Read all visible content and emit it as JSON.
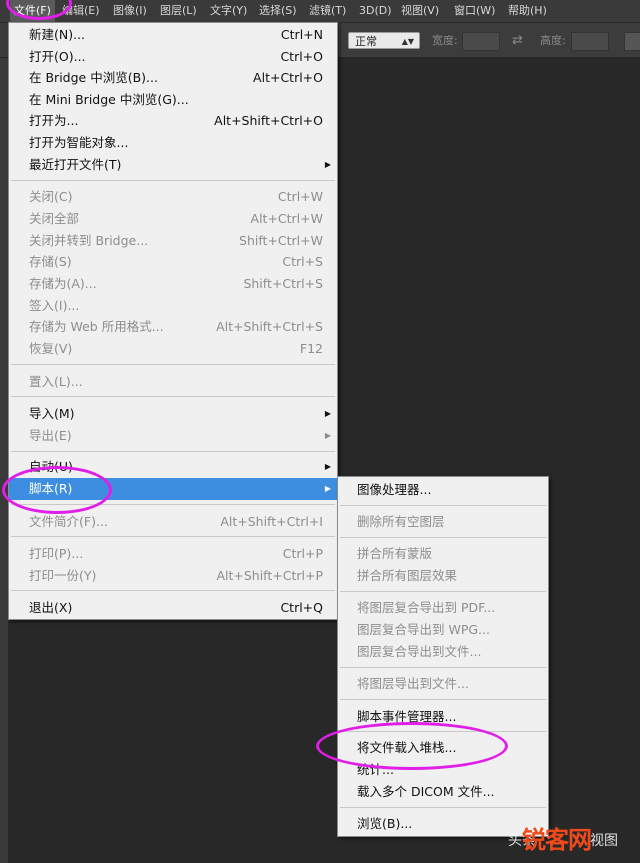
{
  "menubar": {
    "items": [
      {
        "label": "文件(F)"
      },
      {
        "label": "编辑(E)"
      },
      {
        "label": "图像(I)"
      },
      {
        "label": "图层(L)"
      },
      {
        "label": "文字(Y)"
      },
      {
        "label": "选择(S)"
      },
      {
        "label": "滤镜(T)"
      },
      {
        "label": "3D(D)"
      },
      {
        "label": "视图(V)"
      },
      {
        "label": "窗口(W)"
      },
      {
        "label": "帮助(H)"
      }
    ]
  },
  "options_bar": {
    "style_value": "正常",
    "width_label": "宽度:",
    "height_label": "高度:"
  },
  "file_menu": {
    "items": [
      {
        "label": "新建(N)...",
        "shortcut": "Ctrl+N"
      },
      {
        "label": "打开(O)...",
        "shortcut": "Ctrl+O"
      },
      {
        "label": "在 Bridge 中浏览(B)...",
        "shortcut": "Alt+Ctrl+O"
      },
      {
        "label": "在 Mini Bridge 中浏览(G)...",
        "shortcut": ""
      },
      {
        "label": "打开为...",
        "shortcut": "Alt+Shift+Ctrl+O"
      },
      {
        "label": "打开为智能对象...",
        "shortcut": ""
      },
      {
        "label": "最近打开文件(T)",
        "shortcut": ""
      },
      {
        "label": "关闭(C)",
        "shortcut": "Ctrl+W"
      },
      {
        "label": "关闭全部",
        "shortcut": "Alt+Ctrl+W"
      },
      {
        "label": "关闭并转到 Bridge...",
        "shortcut": "Shift+Ctrl+W"
      },
      {
        "label": "存储(S)",
        "shortcut": "Ctrl+S"
      },
      {
        "label": "存储为(A)...",
        "shortcut": "Shift+Ctrl+S"
      },
      {
        "label": "签入(I)...",
        "shortcut": ""
      },
      {
        "label": "存储为 Web 所用格式...",
        "shortcut": "Alt+Shift+Ctrl+S"
      },
      {
        "label": "恢复(V)",
        "shortcut": "F12"
      },
      {
        "label": "置入(L)...",
        "shortcut": ""
      },
      {
        "label": "导入(M)",
        "shortcut": ""
      },
      {
        "label": "导出(E)",
        "shortcut": ""
      },
      {
        "label": "自动(U)",
        "shortcut": ""
      },
      {
        "label": "脚本(R)",
        "shortcut": ""
      },
      {
        "label": "文件简介(F)...",
        "shortcut": "Alt+Shift+Ctrl+I"
      },
      {
        "label": "打印(P)...",
        "shortcut": "Ctrl+P"
      },
      {
        "label": "打印一份(Y)",
        "shortcut": "Alt+Shift+Ctrl+P"
      },
      {
        "label": "退出(X)",
        "shortcut": "Ctrl+Q"
      }
    ]
  },
  "scripts_submenu": {
    "items": [
      {
        "label": "图像处理器..."
      },
      {
        "label": "删除所有空图层"
      },
      {
        "label": "拼合所有蒙版"
      },
      {
        "label": "拼合所有图层效果"
      },
      {
        "label": "将图层复合导出到 PDF..."
      },
      {
        "label": "图层复合导出到 WPG..."
      },
      {
        "label": "图层复合导出到文件..."
      },
      {
        "label": "将图层导出到文件..."
      },
      {
        "label": "脚本事件管理器..."
      },
      {
        "label": "将文件载入堆栈..."
      },
      {
        "label": "统计..."
      },
      {
        "label": "载入多个 DICOM 文件..."
      },
      {
        "label": "浏览(B)..."
      }
    ]
  },
  "watermark": {
    "left_text": "头条",
    "brand_text": "锐客网",
    "right_text": "视图"
  },
  "colors": {
    "highlight": "#3d8ee0",
    "annotation": "#e01ee8",
    "watermark_brand": "#f04a1a"
  }
}
